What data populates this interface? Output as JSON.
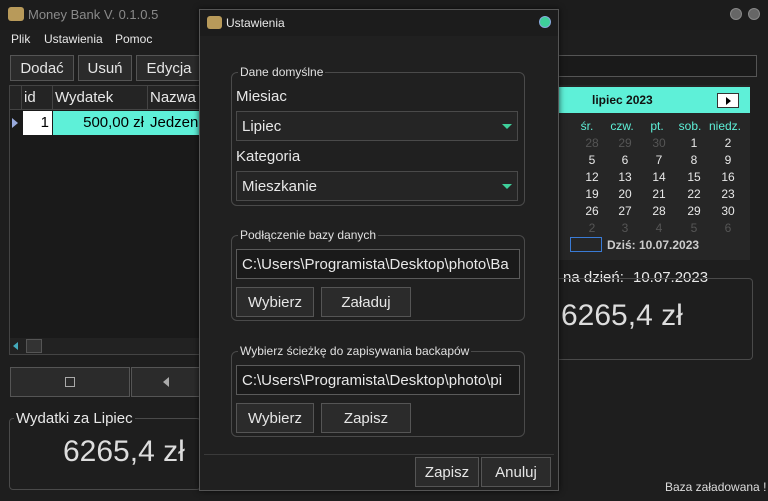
{
  "app": {
    "title": "Money Bank V. 0.1.0.5"
  },
  "menu": [
    "Plik",
    "Ustawienia",
    "Pomoc"
  ],
  "toolbar": {
    "add": "Dodać",
    "remove": "Usuń",
    "edit": "Edycja"
  },
  "table": {
    "headers": [
      "id",
      "Wydatek",
      "Nazwa"
    ],
    "row": {
      "id": "1",
      "amount": "500,00 zł",
      "name": "Jedzen"
    }
  },
  "expenses": {
    "title": "Wydatki za Lipiec",
    "value": "6265,4 zł"
  },
  "calendar": {
    "month_label": "lipiec 2023",
    "weekdays": [
      "śr.",
      "czw.",
      "pt.",
      "sob.",
      "niedz."
    ],
    "rows": [
      [
        "28",
        "29",
        "30",
        "1",
        "2"
      ],
      [
        "5",
        "6",
        "7",
        "8",
        "9"
      ],
      [
        "12",
        "13",
        "14",
        "15",
        "16"
      ],
      [
        "19",
        "20",
        "21",
        "22",
        "23"
      ],
      [
        "26",
        "27",
        "28",
        "29",
        "30"
      ],
      [
        "2",
        "3",
        "4",
        "5",
        "6"
      ]
    ],
    "today": "Dziś: 10.07.2023"
  },
  "balance": {
    "label": "na dzień:",
    "date": "10.07.2023",
    "value": "6265,4 zł"
  },
  "status": "Baza załadowana !",
  "dialog": {
    "title": "Ustawienia",
    "defaults_group": "Dane domyślne",
    "month_label": "Miesiac",
    "month_value": "Lipiec",
    "category_label": "Kategoria",
    "category_value": "Mieszkanie",
    "db_group": "Podłączenie bazy danych",
    "db_path": "C:\\Users\\Programista\\Desktop\\photo\\Ba",
    "db_choose": "Wybierz",
    "db_load": "Załaduj",
    "backup_group": "Wybierz ścieżkę do zapisywania backapów",
    "backup_path": "C:\\Users\\Programista\\Desktop\\photo\\pi",
    "backup_choose": "Wybierz",
    "backup_save": "Zapisz",
    "save": "Zapisz",
    "cancel": "Anuluj"
  }
}
